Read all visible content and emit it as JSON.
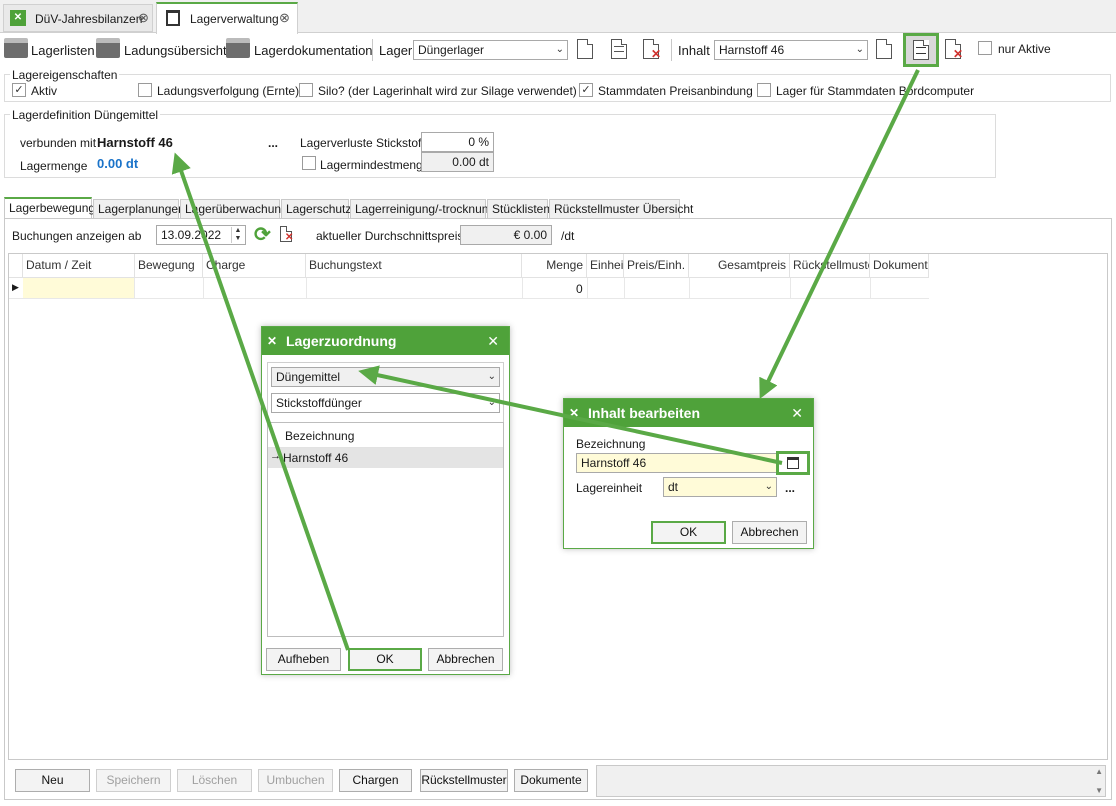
{
  "tabs": [
    {
      "label": "DüV-Jahresbilanzen",
      "active": false
    },
    {
      "label": "Lagerverwaltung",
      "active": true
    }
  ],
  "toolbar": {
    "lagerlisten": "Lagerlisten",
    "ladungsuebersicht": "Ladungsübersicht",
    "lagerdokumentation": "Lagerdokumentation",
    "lager_label": "Lager",
    "lager_value": "Düngerlager",
    "inhalt_label": "Inhalt",
    "inhalt_value": "Harnstoff 46",
    "nur_aktive": "nur Aktive"
  },
  "eigenschaften": {
    "title": "Lagereigenschaften",
    "aktiv": "Aktiv",
    "ladungsverfolgung": "Ladungsverfolgung (Ernte)",
    "silo": "Silo?  (der Lagerinhalt wird zur Silage verwendet)",
    "stammdaten_preis": "Stammdaten Preisanbindung",
    "bordcomputer": "Lager für Stammdaten Bordcomputer"
  },
  "definition": {
    "title": "Lagerdefinition Düngemittel",
    "verbunden_label": "verbunden mit",
    "verbunden_value": "Harnstoff 46",
    "menge_label": "Lagermenge",
    "menge_value": "0.00 dt",
    "dots": "...",
    "verluste_label": "Lagerverluste Stickstoff",
    "verluste_value": "0 %",
    "mindest_label": "Lagermindestmenge",
    "mindest_value": "0.00 dt"
  },
  "subtabs": [
    "Lagerbewegung",
    "Lagerplanungen",
    "Lagerüberwachung",
    "Lagerschutz",
    "Lagerreinigung/-trocknung",
    "Stücklisten",
    "Rückstellmuster Übersicht"
  ],
  "filter": {
    "label": "Buchungen anzeigen ab",
    "date": "13.09.2022",
    "preis_label": "aktueller Durchschnittspreis",
    "preis_value": "€ 0.00",
    "preis_unit": "/dt"
  },
  "grid": {
    "columns": [
      "Datum / Zeit",
      "Bewegung",
      "Charge",
      "Buchungstext",
      "Menge",
      "Einheit",
      "Preis/Einh.",
      "Gesamtpreis",
      "Rückstellmuster",
      "Dokumente"
    ],
    "row_menge": "0"
  },
  "bottom_buttons": {
    "neu": "Neu",
    "speichern": "Speichern",
    "loeschen": "Löschen",
    "umbuchen": "Umbuchen",
    "chargen": "Chargen",
    "rueckstellmuster": "Rückstellmuster",
    "dokumente": "Dokumente"
  },
  "dialog_lagerzuordnung": {
    "title": "Lagerzuordnung",
    "combo1": "Düngemittel",
    "combo2": "Stickstoffdünger",
    "list_header": "Bezeichnung",
    "list_item": "Harnstoff 46",
    "aufheben": "Aufheben",
    "ok": "OK",
    "abbrechen": "Abbrechen"
  },
  "dialog_inhalt": {
    "title": "Inhalt bearbeiten",
    "bezeichnung_label": "Bezeichnung",
    "bezeichnung_value": "Harnstoff 46",
    "einheit_label": "Lagereinheit",
    "einheit_value": "dt",
    "dots": "...",
    "ok": "OK",
    "abbrechen": "Abbrechen"
  },
  "colors": {
    "accent": "#5aa946",
    "header_green": "#4fa23a",
    "link_blue": "#1a73c9"
  }
}
